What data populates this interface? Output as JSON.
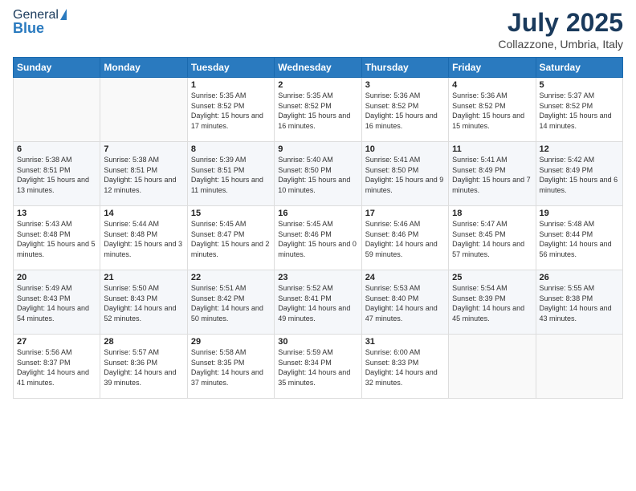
{
  "logo": {
    "general": "General",
    "blue": "Blue"
  },
  "header": {
    "month": "July 2025",
    "location": "Collazzone, Umbria, Italy"
  },
  "weekdays": [
    "Sunday",
    "Monday",
    "Tuesday",
    "Wednesday",
    "Thursday",
    "Friday",
    "Saturday"
  ],
  "weeks": [
    [
      {
        "day": "",
        "sunrise": "",
        "sunset": "",
        "daylight": ""
      },
      {
        "day": "",
        "sunrise": "",
        "sunset": "",
        "daylight": ""
      },
      {
        "day": "1",
        "sunrise": "Sunrise: 5:35 AM",
        "sunset": "Sunset: 8:52 PM",
        "daylight": "Daylight: 15 hours and 17 minutes."
      },
      {
        "day": "2",
        "sunrise": "Sunrise: 5:35 AM",
        "sunset": "Sunset: 8:52 PM",
        "daylight": "Daylight: 15 hours and 16 minutes."
      },
      {
        "day": "3",
        "sunrise": "Sunrise: 5:36 AM",
        "sunset": "Sunset: 8:52 PM",
        "daylight": "Daylight: 15 hours and 16 minutes."
      },
      {
        "day": "4",
        "sunrise": "Sunrise: 5:36 AM",
        "sunset": "Sunset: 8:52 PM",
        "daylight": "Daylight: 15 hours and 15 minutes."
      },
      {
        "day": "5",
        "sunrise": "Sunrise: 5:37 AM",
        "sunset": "Sunset: 8:52 PM",
        "daylight": "Daylight: 15 hours and 14 minutes."
      }
    ],
    [
      {
        "day": "6",
        "sunrise": "Sunrise: 5:38 AM",
        "sunset": "Sunset: 8:51 PM",
        "daylight": "Daylight: 15 hours and 13 minutes."
      },
      {
        "day": "7",
        "sunrise": "Sunrise: 5:38 AM",
        "sunset": "Sunset: 8:51 PM",
        "daylight": "Daylight: 15 hours and 12 minutes."
      },
      {
        "day": "8",
        "sunrise": "Sunrise: 5:39 AM",
        "sunset": "Sunset: 8:51 PM",
        "daylight": "Daylight: 15 hours and 11 minutes."
      },
      {
        "day": "9",
        "sunrise": "Sunrise: 5:40 AM",
        "sunset": "Sunset: 8:50 PM",
        "daylight": "Daylight: 15 hours and 10 minutes."
      },
      {
        "day": "10",
        "sunrise": "Sunrise: 5:41 AM",
        "sunset": "Sunset: 8:50 PM",
        "daylight": "Daylight: 15 hours and 9 minutes."
      },
      {
        "day": "11",
        "sunrise": "Sunrise: 5:41 AM",
        "sunset": "Sunset: 8:49 PM",
        "daylight": "Daylight: 15 hours and 7 minutes."
      },
      {
        "day": "12",
        "sunrise": "Sunrise: 5:42 AM",
        "sunset": "Sunset: 8:49 PM",
        "daylight": "Daylight: 15 hours and 6 minutes."
      }
    ],
    [
      {
        "day": "13",
        "sunrise": "Sunrise: 5:43 AM",
        "sunset": "Sunset: 8:48 PM",
        "daylight": "Daylight: 15 hours and 5 minutes."
      },
      {
        "day": "14",
        "sunrise": "Sunrise: 5:44 AM",
        "sunset": "Sunset: 8:48 PM",
        "daylight": "Daylight: 15 hours and 3 minutes."
      },
      {
        "day": "15",
        "sunrise": "Sunrise: 5:45 AM",
        "sunset": "Sunset: 8:47 PM",
        "daylight": "Daylight: 15 hours and 2 minutes."
      },
      {
        "day": "16",
        "sunrise": "Sunrise: 5:45 AM",
        "sunset": "Sunset: 8:46 PM",
        "daylight": "Daylight: 15 hours and 0 minutes."
      },
      {
        "day": "17",
        "sunrise": "Sunrise: 5:46 AM",
        "sunset": "Sunset: 8:46 PM",
        "daylight": "Daylight: 14 hours and 59 minutes."
      },
      {
        "day": "18",
        "sunrise": "Sunrise: 5:47 AM",
        "sunset": "Sunset: 8:45 PM",
        "daylight": "Daylight: 14 hours and 57 minutes."
      },
      {
        "day": "19",
        "sunrise": "Sunrise: 5:48 AM",
        "sunset": "Sunset: 8:44 PM",
        "daylight": "Daylight: 14 hours and 56 minutes."
      }
    ],
    [
      {
        "day": "20",
        "sunrise": "Sunrise: 5:49 AM",
        "sunset": "Sunset: 8:43 PM",
        "daylight": "Daylight: 14 hours and 54 minutes."
      },
      {
        "day": "21",
        "sunrise": "Sunrise: 5:50 AM",
        "sunset": "Sunset: 8:43 PM",
        "daylight": "Daylight: 14 hours and 52 minutes."
      },
      {
        "day": "22",
        "sunrise": "Sunrise: 5:51 AM",
        "sunset": "Sunset: 8:42 PM",
        "daylight": "Daylight: 14 hours and 50 minutes."
      },
      {
        "day": "23",
        "sunrise": "Sunrise: 5:52 AM",
        "sunset": "Sunset: 8:41 PM",
        "daylight": "Daylight: 14 hours and 49 minutes."
      },
      {
        "day": "24",
        "sunrise": "Sunrise: 5:53 AM",
        "sunset": "Sunset: 8:40 PM",
        "daylight": "Daylight: 14 hours and 47 minutes."
      },
      {
        "day": "25",
        "sunrise": "Sunrise: 5:54 AM",
        "sunset": "Sunset: 8:39 PM",
        "daylight": "Daylight: 14 hours and 45 minutes."
      },
      {
        "day": "26",
        "sunrise": "Sunrise: 5:55 AM",
        "sunset": "Sunset: 8:38 PM",
        "daylight": "Daylight: 14 hours and 43 minutes."
      }
    ],
    [
      {
        "day": "27",
        "sunrise": "Sunrise: 5:56 AM",
        "sunset": "Sunset: 8:37 PM",
        "daylight": "Daylight: 14 hours and 41 minutes."
      },
      {
        "day": "28",
        "sunrise": "Sunrise: 5:57 AM",
        "sunset": "Sunset: 8:36 PM",
        "daylight": "Daylight: 14 hours and 39 minutes."
      },
      {
        "day": "29",
        "sunrise": "Sunrise: 5:58 AM",
        "sunset": "Sunset: 8:35 PM",
        "daylight": "Daylight: 14 hours and 37 minutes."
      },
      {
        "day": "30",
        "sunrise": "Sunrise: 5:59 AM",
        "sunset": "Sunset: 8:34 PM",
        "daylight": "Daylight: 14 hours and 35 minutes."
      },
      {
        "day": "31",
        "sunrise": "Sunrise: 6:00 AM",
        "sunset": "Sunset: 8:33 PM",
        "daylight": "Daylight: 14 hours and 32 minutes."
      },
      {
        "day": "",
        "sunrise": "",
        "sunset": "",
        "daylight": ""
      },
      {
        "day": "",
        "sunrise": "",
        "sunset": "",
        "daylight": ""
      }
    ]
  ]
}
